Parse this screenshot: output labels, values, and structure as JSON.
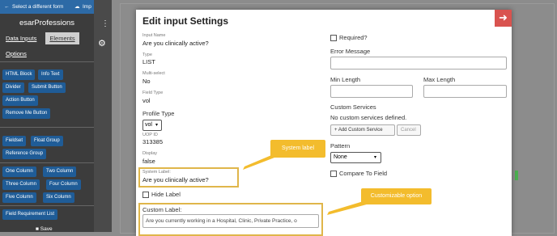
{
  "sidebar": {
    "select_form": "Select a different form",
    "import": "Imp",
    "form_title": "esarProfessions",
    "tabs": [
      "Data Inputs",
      "Elements",
      "Options"
    ],
    "elements": [
      "HTML Block",
      "Info Text",
      "Divider",
      "Submit Button",
      "Action Button",
      "Remove Me Button",
      "Fieldset",
      "Float Group",
      "Reference Group",
      "One Column",
      "Two Column",
      "Three Column",
      "Four Column",
      "Five Column",
      "Six Column",
      "Field Requirement List"
    ],
    "save": "Save"
  },
  "modal": {
    "title": "Edit input Settings",
    "left": {
      "input_name_label": "Input Name",
      "input_name_value": "Are you clinically active?",
      "type_label": "Type",
      "type_value": "LIST",
      "multiselect_label": "Multi-select",
      "multiselect_value": "No",
      "field_type_label": "Field Type",
      "field_type_value": "vol",
      "profile_type_label": "Profile Type",
      "profile_type_value": "vol",
      "uop_id_label": "UOP ID",
      "uop_id_value": "313385",
      "display_label": "Display",
      "display_value": "false",
      "system_label_label": "System Label:",
      "system_label_value": "Are you clinically active?",
      "hide_label": "Hide Label",
      "custom_label_label": "Custom Label:",
      "custom_label_value": "Are you currently working in a Hospital, Clinic, Private Practice, o"
    },
    "right": {
      "required": "Required?",
      "error_message": "Error Message",
      "min_length": "Min Length",
      "max_length": "Max Length",
      "custom_services": "Custom Services",
      "no_custom_services": "No custom services defined.",
      "add_custom_service": "+ Add Custom Service",
      "cancel": "Cancel",
      "pattern": "Pattern",
      "pattern_value": "None",
      "compare_to_field": "Compare To Field"
    }
  },
  "callouts": {
    "system_label": "System label",
    "customizable_option": "Customizable option"
  },
  "colors": {
    "sidebar_bg": "#3c3c3c",
    "pill_blue": "#1f5c97",
    "callout_yellow": "#f3bc2d",
    "close_red": "#d9534f"
  }
}
